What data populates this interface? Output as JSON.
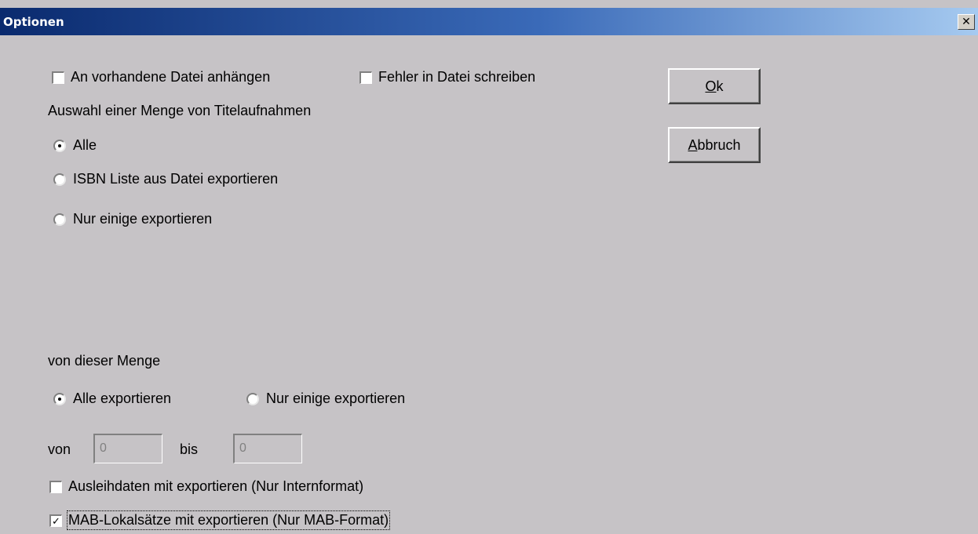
{
  "window": {
    "title": "Optionen",
    "close_glyph": "✕"
  },
  "options": {
    "append_label": "An vorhandene Datei anhängen",
    "errors_label": "Fehler in Datei schreiben"
  },
  "selection": {
    "heading": "Auswahl einer Menge von Titelaufnahmen",
    "radios": [
      {
        "label": "Alle",
        "checked": true
      },
      {
        "label": "ISBN Liste aus Datei exportieren",
        "checked": false
      },
      {
        "label": "Nur einige exportieren",
        "checked": false
      }
    ]
  },
  "subset": {
    "heading": "von dieser Menge",
    "all_label": "Alle exportieren",
    "some_label": "Nur einige exportieren",
    "from_label": "von",
    "to_label": "bis",
    "from_value": "0",
    "to_value": "0"
  },
  "extras": {
    "loan_label": "Ausleihdaten mit exportieren (Nur Internformat)",
    "mab_label": "MAB-Lokalsätze mit exportieren (Nur MAB-Format)",
    "mab_checked": true,
    "check_glyph": "✓"
  },
  "buttons": {
    "ok_mnemonic": "O",
    "ok_rest": "k",
    "cancel_mnemonic": "A",
    "cancel_rest": "bbruch"
  }
}
